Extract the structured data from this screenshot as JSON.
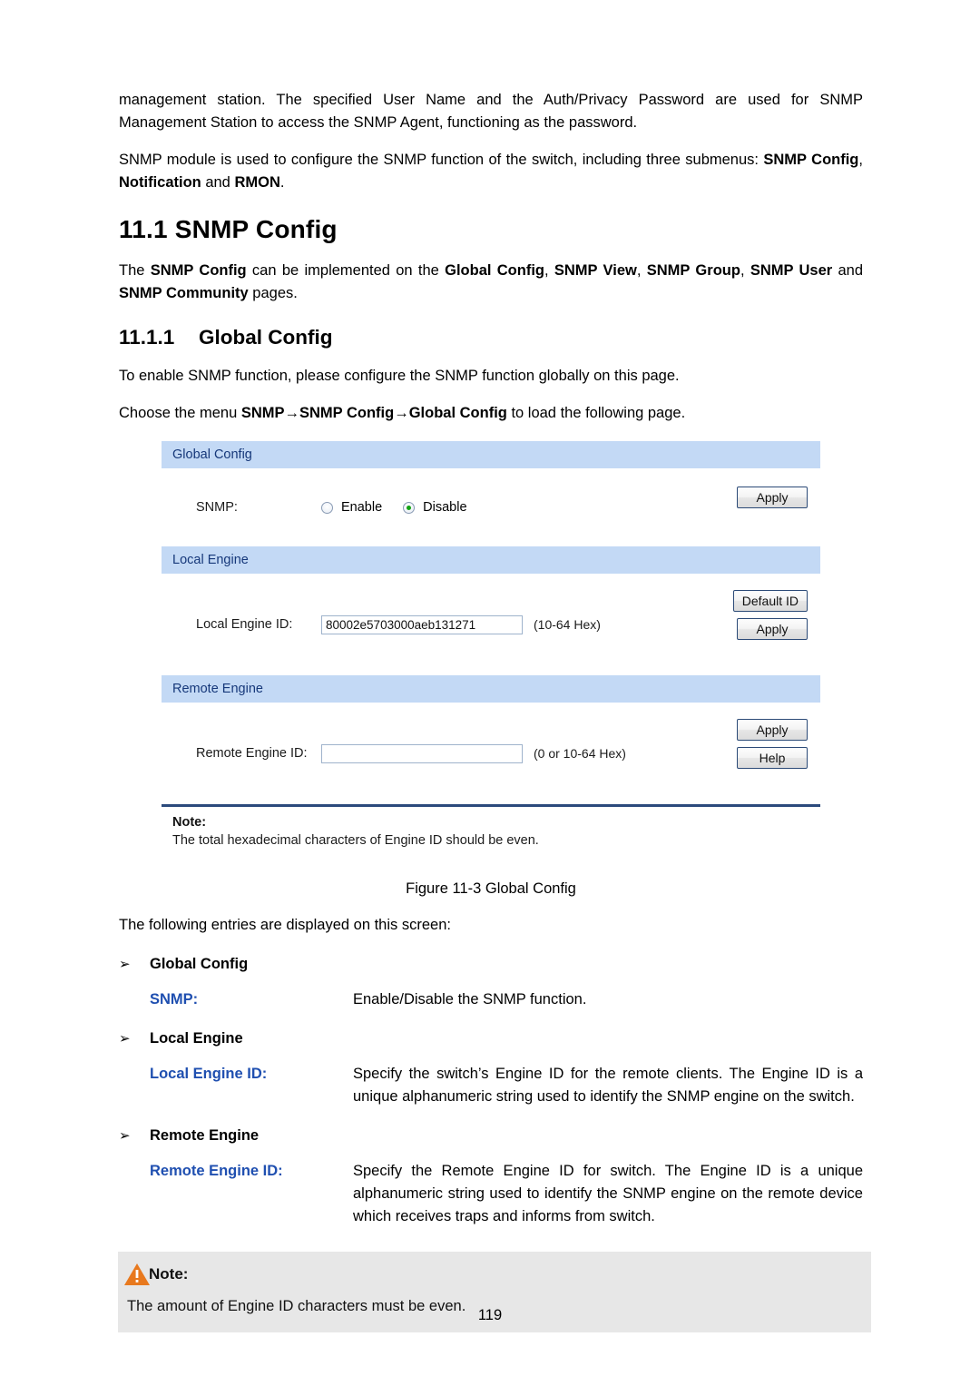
{
  "document": {
    "page_number": "119"
  },
  "intro": {
    "para1": "management station. The specified User Name and the Auth/Privacy Password are used for SNMP Management Station to access the SNMP Agent, functioning as the password.",
    "para2_prefix": "SNMP module is used to configure the SNMP function of the switch, including three submenus: ",
    "para2_bold1": "SNMP Config",
    "para2_mid1": ", ",
    "para2_bold2": "Notification",
    "para2_mid2": " and ",
    "para2_bold3": "RMON",
    "para2_suffix": "."
  },
  "section": {
    "heading": "11.1 SNMP Config",
    "para_prefix": "The ",
    "para_bold1": "SNMP Config",
    "para_mid1": " can be implemented on the ",
    "para_bold2": "Global Config",
    "para_mid2": ", ",
    "para_bold3": "SNMP View",
    "para_mid3": ", ",
    "para_bold4": "SNMP Group",
    "para_mid4": ", ",
    "para_bold5": "SNMP User",
    "para_mid5": " and ",
    "para_bold6": "SNMP Community",
    "para_suffix": " pages."
  },
  "subsection": {
    "number": "11.1.1",
    "title": "Global Config",
    "para1": "To enable SNMP function, please configure the SNMP function globally on this page.",
    "para2_prefix": "Choose the menu ",
    "para2_bold": "SNMP→SNMP Config→Global Config",
    "para2_suffix": " to load the following page."
  },
  "figure": {
    "caption": "Figure 11-3 Global Config",
    "panels": {
      "global_config": {
        "header": "Global Config",
        "snmp_label": "SNMP:",
        "radio_enable_label": "Enable",
        "radio_disable_label": "Disable",
        "selected": "Disable",
        "apply_button": "Apply"
      },
      "local_engine": {
        "header": "Local Engine",
        "label": "Local Engine ID:",
        "value": "80002e5703000aeb131271",
        "hint": "(10-64 Hex)",
        "default_id_button": "Default ID",
        "apply_button": "Apply"
      },
      "remote_engine": {
        "header": "Remote Engine",
        "label": "Remote Engine ID:",
        "value": "",
        "placeholder": "",
        "hint": "(0 or 10-64 Hex)",
        "apply_button": "Apply",
        "help_button": "Help"
      }
    },
    "note": {
      "title": "Note:",
      "text": "The total hexadecimal characters of Engine ID should be even."
    },
    "colors": {
      "panel_header_bg": "#c3d9f5",
      "panel_header_text": "#16387a",
      "radio_selected_dot": "#13a313",
      "button_border": "#2b4a77",
      "divider": "#2b4a7c"
    }
  },
  "entries": {
    "intro": "The following entries are displayed on this screen:",
    "bullet_glyph": "➢",
    "groups": [
      {
        "label": "Global Config",
        "items": [
          {
            "term": "SNMP:",
            "desc": "Enable/Disable the SNMP function."
          }
        ]
      },
      {
        "label": "Local Engine",
        "items": [
          {
            "term": "Local Engine ID:",
            "desc": "Specify the switch’s Engine ID for the remote clients. The Engine ID is a unique alphanumeric string used to identify the SNMP engine on the switch."
          }
        ]
      },
      {
        "label": "Remote Engine",
        "items": [
          {
            "term": "Remote Engine ID:",
            "desc": "Specify the Remote Engine ID for switch. The Engine ID is a unique alphanumeric string used to identify the SNMP engine on the remote device which receives traps and informs from switch."
          }
        ]
      }
    ]
  },
  "bottom_note": {
    "title": "Note:",
    "icon": "warning-triangle-icon",
    "text": "The amount of Engine ID characters must be even.",
    "icon_color": "#e8791e",
    "bg_color": "#e7e7e7"
  }
}
